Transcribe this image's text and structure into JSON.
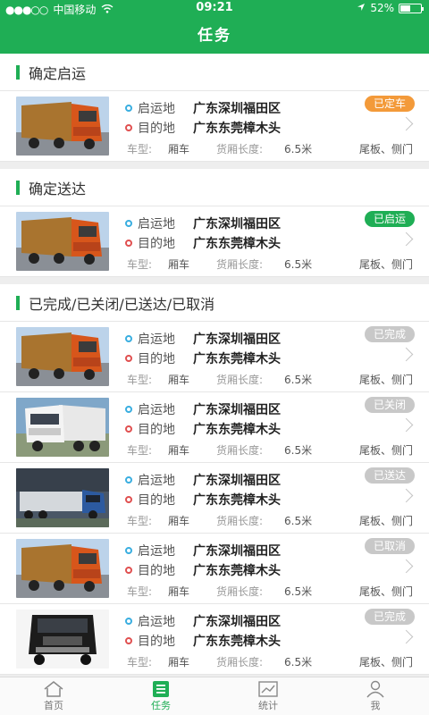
{
  "status_bar": {
    "carrier": "中国移动",
    "time": "09:21",
    "battery_text": "52%",
    "battery_level": 0.52
  },
  "nav": {
    "title": "任务"
  },
  "labels": {
    "origin": "启运地",
    "destination": "目的地",
    "vehicle_type": "车型:",
    "cargo_length": "货厢长度:"
  },
  "sections": [
    {
      "title": "确定启运",
      "cards": [
        {
          "origin": "广东深圳福田区",
          "destination": "广东东莞樟木头",
          "vehicle_type": "厢车",
          "length": "6.5米",
          "extra": "尾板、侧门",
          "status": "已定车",
          "status_color": "#f39a3a",
          "image": "orange-truck"
        }
      ]
    },
    {
      "title": "确定送达",
      "cards": [
        {
          "origin": "广东深圳福田区",
          "destination": "广东东莞樟木头",
          "vehicle_type": "厢车",
          "length": "6.5米",
          "extra": "尾板、侧门",
          "status": "已启运",
          "status_color": "#1fae55",
          "image": "orange-truck"
        }
      ]
    },
    {
      "title": "已完成/已关闭/已送达/已取消",
      "cards": [
        {
          "origin": "广东深圳福田区",
          "destination": "广东东莞樟木头",
          "vehicle_type": "厢车",
          "length": "6.5米",
          "extra": "尾板、侧门",
          "status": "已完成",
          "status_color": "#c8c8c8",
          "image": "orange-truck"
        },
        {
          "origin": "广东深圳福田区",
          "destination": "广东东莞樟木头",
          "vehicle_type": "厢车",
          "length": "6.5米",
          "extra": "尾板、侧门",
          "status": "已关闭",
          "status_color": "#c8c8c8",
          "image": "white-truck"
        },
        {
          "origin": "广东深圳福田区",
          "destination": "广东东莞樟木头",
          "vehicle_type": "厢车",
          "length": "6.5米",
          "extra": "尾板、侧门",
          "status": "已送达",
          "status_color": "#c8c8c8",
          "image": "blue-truck"
        },
        {
          "origin": "广东深圳福田区",
          "destination": "广东东莞樟木头",
          "vehicle_type": "厢车",
          "length": "6.5米",
          "extra": "尾板、侧门",
          "status": "已取消",
          "status_color": "#c8c8c8",
          "image": "orange-truck"
        },
        {
          "origin": "广东深圳福田区",
          "destination": "广东东莞樟木头",
          "vehicle_type": "厢车",
          "length": "6.5米",
          "extra": "尾板、侧门",
          "status": "已完成",
          "status_color": "#c8c8c8",
          "image": "black-truck"
        }
      ]
    }
  ],
  "tabbar": [
    {
      "label": "首页",
      "icon": "home-icon",
      "active": false
    },
    {
      "label": "任务",
      "icon": "task-icon",
      "active": true
    },
    {
      "label": "统计",
      "icon": "chart-icon",
      "active": false
    },
    {
      "label": "我",
      "icon": "user-icon",
      "active": false
    }
  ],
  "colors": {
    "primary": "#1fae55",
    "orange": "#f39a3a",
    "gray_badge": "#c8c8c8"
  }
}
